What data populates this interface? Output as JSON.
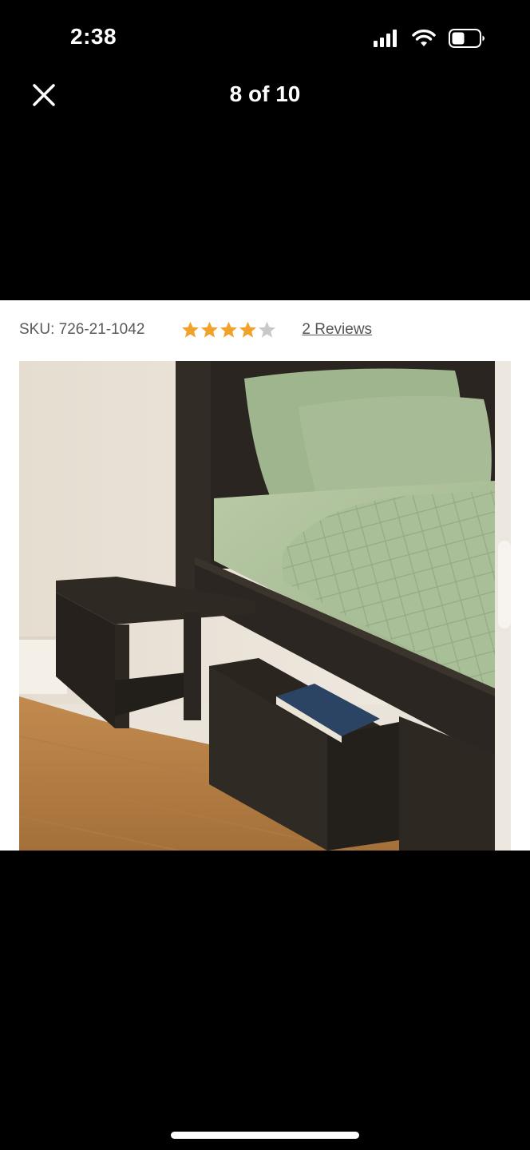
{
  "status_bar": {
    "time": "2:38",
    "icons": [
      "signal-icon",
      "wifi-icon",
      "battery-icon"
    ]
  },
  "viewer": {
    "counter": "8 of 10",
    "close_icon": "close-icon"
  },
  "product": {
    "sku": "SKU: 726-21-1042",
    "rating": 4,
    "rating_max": 5,
    "reviews_label": "2 Reviews",
    "image_icon": "product-photo"
  },
  "colors": {
    "star_filled": "#F2A22B",
    "star_empty": "#C8C8C8",
    "background": "#000000"
  }
}
